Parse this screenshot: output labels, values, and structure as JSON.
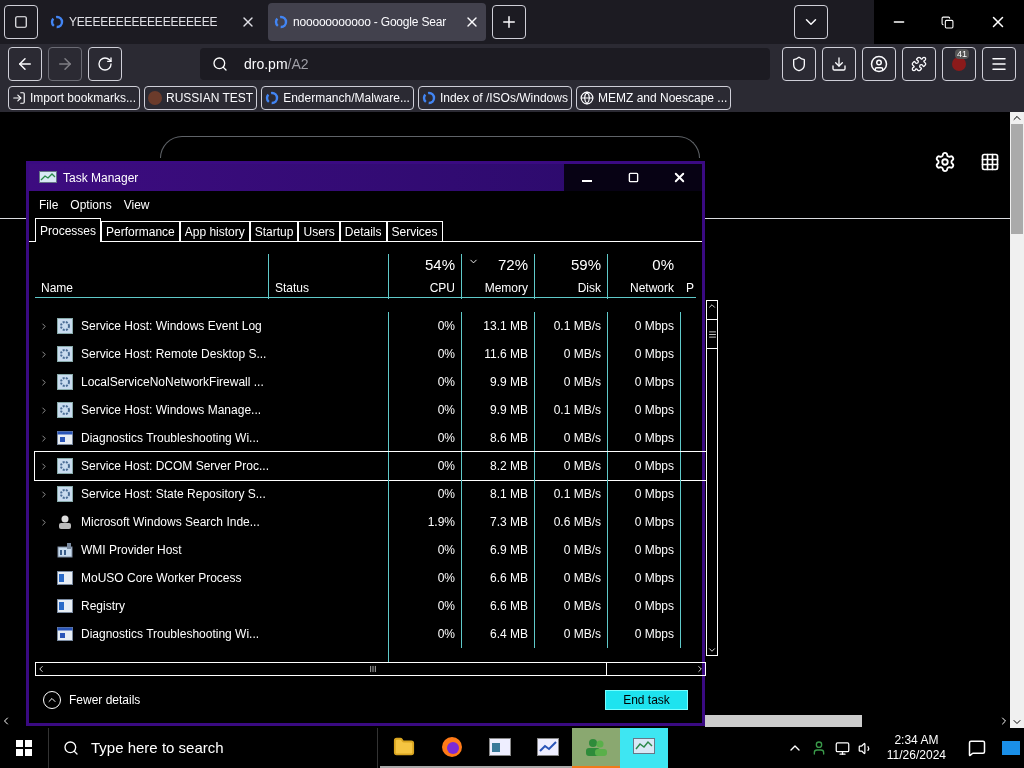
{
  "browser": {
    "tabs": [
      {
        "title": "YEEEEEEEEEEEEEEEEEE",
        "selected": false
      },
      {
        "title": "nooooooooooo - Google Sear",
        "selected": true
      }
    ],
    "address": {
      "host": "dro.pm",
      "path": "/A2"
    },
    "extension_badge": "41",
    "bookmarks": [
      {
        "kind": "import",
        "label": "Import bookmarks..."
      },
      {
        "kind": "avatar",
        "label": "RUSSIAN TEST"
      },
      {
        "kind": "google",
        "label": "Endermanch/Malware..."
      },
      {
        "kind": "google",
        "label": "Index of /ISOs/Windows"
      },
      {
        "kind": "globe",
        "label": "MEMZ and Noescape ..."
      }
    ]
  },
  "task_manager": {
    "title": "Task Manager",
    "menu": [
      "File",
      "Options",
      "View"
    ],
    "tabs": [
      {
        "label": "Processes",
        "selected": true
      },
      {
        "label": "Performance",
        "selected": false
      },
      {
        "label": "App history",
        "selected": false
      },
      {
        "label": "Startup",
        "selected": false
      },
      {
        "label": "Users",
        "selected": false
      },
      {
        "label": "Details",
        "selected": false
      },
      {
        "label": "Services",
        "selected": false
      }
    ],
    "columns": [
      {
        "label": "Name",
        "sorted": false
      },
      {
        "label": "Status",
        "sorted": false
      },
      {
        "label": "CPU",
        "usage": "54%",
        "sorted": false
      },
      {
        "label": "Memory",
        "usage": "72%",
        "sorted": true
      },
      {
        "label": "Disk",
        "usage": "59%",
        "sorted": false
      },
      {
        "label": "Network",
        "usage": "0%",
        "sorted": false
      },
      {
        "label": "P",
        "sorted": false
      }
    ],
    "rows": [
      {
        "kind": "service",
        "expandable": true,
        "selected": false,
        "name": "Service Host: Windows Event Log",
        "cpu": "0%",
        "memory": "13.1 MB",
        "disk": "0.1 MB/s",
        "network": "0 Mbps"
      },
      {
        "kind": "service",
        "expandable": true,
        "selected": false,
        "name": "Service Host: Remote Desktop S...",
        "cpu": "0%",
        "memory": "11.6 MB",
        "disk": "0 MB/s",
        "network": "0 Mbps"
      },
      {
        "kind": "service",
        "expandable": true,
        "selected": false,
        "name": "LocalServiceNoNetworkFirewall ...",
        "cpu": "0%",
        "memory": "9.9 MB",
        "disk": "0 MB/s",
        "network": "0 Mbps"
      },
      {
        "kind": "service",
        "expandable": true,
        "selected": false,
        "name": "Service Host: Windows Manage...",
        "cpu": "0%",
        "memory": "9.9 MB",
        "disk": "0.1 MB/s",
        "network": "0 Mbps"
      },
      {
        "kind": "diagnostics",
        "expandable": true,
        "selected": false,
        "name": "Diagnostics Troubleshooting Wi...",
        "cpu": "0%",
        "memory": "8.6 MB",
        "disk": "0 MB/s",
        "network": "0 Mbps"
      },
      {
        "kind": "service",
        "expandable": true,
        "selected": true,
        "name": "Service Host: DCOM Server Proc...",
        "cpu": "0%",
        "memory": "8.2 MB",
        "disk": "0 MB/s",
        "network": "0 Mbps"
      },
      {
        "kind": "service",
        "expandable": true,
        "selected": false,
        "name": "Service Host: State Repository S...",
        "cpu": "0%",
        "memory": "8.1 MB",
        "disk": "0.1 MB/s",
        "network": "0 Mbps"
      },
      {
        "kind": "indexer",
        "expandable": true,
        "selected": false,
        "name": "Microsoft Windows Search Inde...",
        "cpu": "1.9%",
        "memory": "7.3 MB",
        "disk": "0.6 MB/s",
        "network": "0 Mbps"
      },
      {
        "kind": "wmi",
        "expandable": false,
        "selected": false,
        "name": "WMI Provider Host",
        "cpu": "0%",
        "memory": "6.9 MB",
        "disk": "0 MB/s",
        "network": "0 Mbps"
      },
      {
        "kind": "window",
        "expandable": false,
        "selected": false,
        "name": "MoUSO Core Worker Process",
        "cpu": "0%",
        "memory": "6.6 MB",
        "disk": "0 MB/s",
        "network": "0 Mbps"
      },
      {
        "kind": "window",
        "expandable": false,
        "selected": false,
        "name": "Registry",
        "cpu": "0%",
        "memory": "6.6 MB",
        "disk": "0 MB/s",
        "network": "0 Mbps"
      },
      {
        "kind": "diagnostics",
        "expandable": false,
        "selected": false,
        "name": "Diagnostics Troubleshooting Wi...",
        "cpu": "0%",
        "memory": "6.4 MB",
        "disk": "0 MB/s",
        "network": "0 Mbps"
      }
    ],
    "fewer_details": "Fewer details",
    "end_task": "End task"
  },
  "taskbar": {
    "search_placeholder": "Type here to search",
    "apps": [
      {
        "kind": "folder",
        "active": false
      },
      {
        "kind": "firefox",
        "active": false
      },
      {
        "kind": "window",
        "active": false
      },
      {
        "kind": "chart",
        "active": false
      },
      {
        "kind": "people",
        "active": true
      },
      {
        "kind": "taskmgr",
        "active": true
      }
    ],
    "time": "2:34 AM",
    "date": "11/26/2024"
  }
}
